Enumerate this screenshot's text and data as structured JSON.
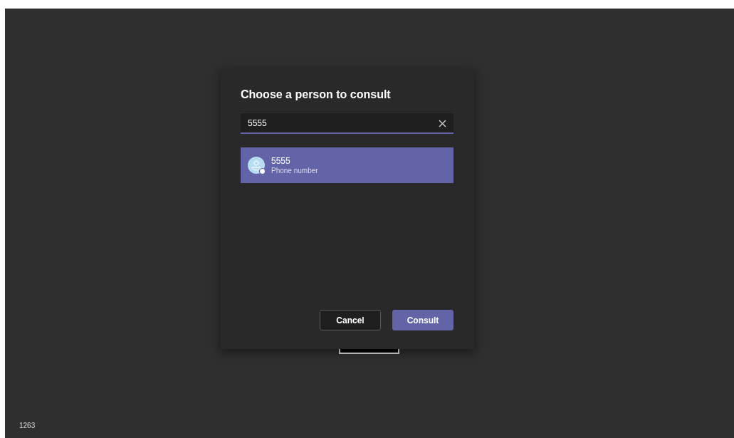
{
  "dialog": {
    "title": "Choose a person to consult",
    "search": {
      "value": "5555"
    },
    "results": [
      {
        "name": "5555",
        "detail": "Phone number",
        "selected": true
      }
    ],
    "buttons": [
      {
        "label": "Cancel",
        "kind": "secondary"
      },
      {
        "label": "Consult",
        "kind": "primary"
      }
    ]
  },
  "corner_label": "1263"
}
